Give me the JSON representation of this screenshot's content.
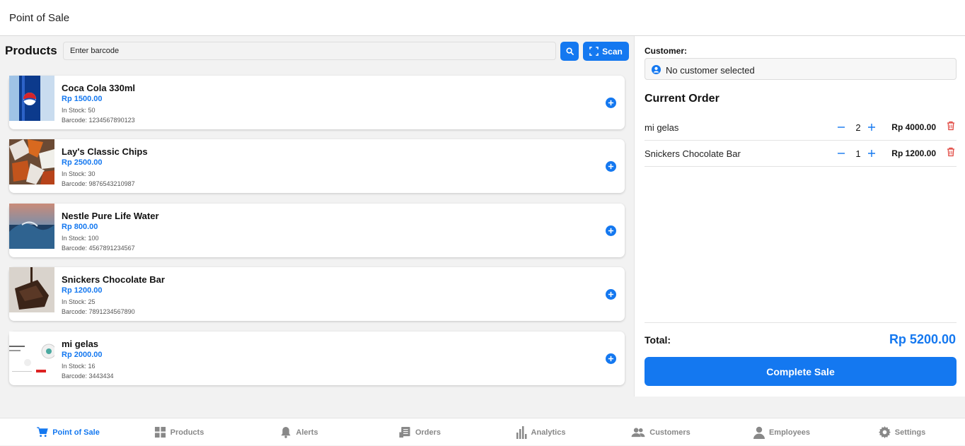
{
  "header": {
    "title": "Point of Sale"
  },
  "products_panel": {
    "heading": "Products",
    "barcode_placeholder": "Enter barcode",
    "scan_label": "Scan",
    "items": [
      {
        "name": "Coca Cola 330ml",
        "price": "Rp 1500.00",
        "stock": "In Stock: 50",
        "barcode": "Barcode: 1234567890123"
      },
      {
        "name": "Lay's Classic Chips",
        "price": "Rp 2500.00",
        "stock": "In Stock: 30",
        "barcode": "Barcode: 9876543210987"
      },
      {
        "name": "Nestle Pure Life Water",
        "price": "Rp 800.00",
        "stock": "In Stock: 100",
        "barcode": "Barcode: 4567891234567"
      },
      {
        "name": "Snickers Chocolate Bar",
        "price": "Rp 1200.00",
        "stock": "In Stock: 25",
        "barcode": "Barcode: 7891234567890"
      },
      {
        "name": "mi gelas",
        "price": "Rp 2000.00",
        "stock": "In Stock: 16",
        "barcode": "Barcode: 3443434"
      }
    ]
  },
  "order_panel": {
    "customer_label": "Customer:",
    "customer_value": "No customer selected",
    "title": "Current Order",
    "items": [
      {
        "name": "mi gelas",
        "qty": "2",
        "total": "Rp 4000.00"
      },
      {
        "name": "Snickers Chocolate Bar",
        "qty": "1",
        "total": "Rp 1200.00"
      }
    ],
    "total_label": "Total:",
    "total_value": "Rp 5200.00",
    "complete_label": "Complete Sale"
  },
  "nav": {
    "items": [
      {
        "label": "Point of Sale",
        "icon": "cart-icon"
      },
      {
        "label": "Products",
        "icon": "grid-icon"
      },
      {
        "label": "Alerts",
        "icon": "bell-icon"
      },
      {
        "label": "Orders",
        "icon": "receipt-icon"
      },
      {
        "label": "Analytics",
        "icon": "bar-chart-icon"
      },
      {
        "label": "Customers",
        "icon": "users-icon"
      },
      {
        "label": "Employees",
        "icon": "person-icon"
      },
      {
        "label": "Settings",
        "icon": "gear-icon"
      }
    ]
  },
  "colors": {
    "accent": "#1478f0",
    "danger": "#e0413a",
    "muted": "#888888"
  }
}
